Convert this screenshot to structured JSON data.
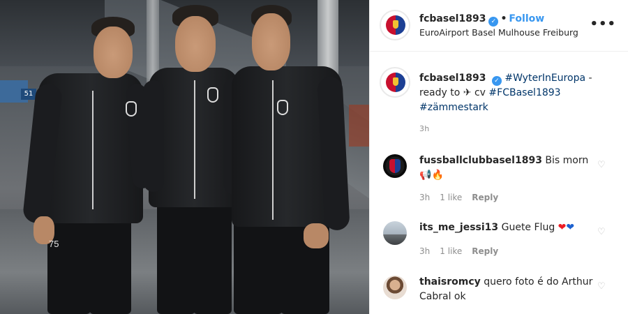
{
  "header": {
    "username": "fcbasel1893",
    "verified_icon": "verified-badge-icon",
    "separator": "•",
    "follow_label": "Follow",
    "location": "EuroAirport Basel Mulhouse Freiburg",
    "more_icon": "more-options-icon",
    "more_glyph": "•••"
  },
  "photo": {
    "shirt_numbers": [
      "75"
    ],
    "sign_number": "51"
  },
  "caption": {
    "username": "fcbasel1893",
    "hashtag1": "#WyterInEuropa",
    "text1": " -",
    "text2": "ready to ",
    "text3": " cv ",
    "hashtag2": "#FCBasel1893",
    "hashtag3": "#zämmestark",
    "time": "3h"
  },
  "comments": [
    {
      "username": "fussballclubbasel1893",
      "text": "Bis morn",
      "emojis": [
        "📢",
        "🔥"
      ],
      "time": "3h",
      "likes": "1 like",
      "reply": "Reply"
    },
    {
      "username": "its_me_jessi13",
      "text": "Guete Flug",
      "emojis": [
        "❤",
        "❤"
      ],
      "time": "3h",
      "likes": "1 like",
      "reply": "Reply"
    },
    {
      "username": "thaisromcy",
      "text": "quero foto é do Arthur Cabral ok"
    }
  ],
  "colors": {
    "link_blue": "#3897f0",
    "hashtag": "#003569",
    "muted": "#8e8e8e"
  }
}
